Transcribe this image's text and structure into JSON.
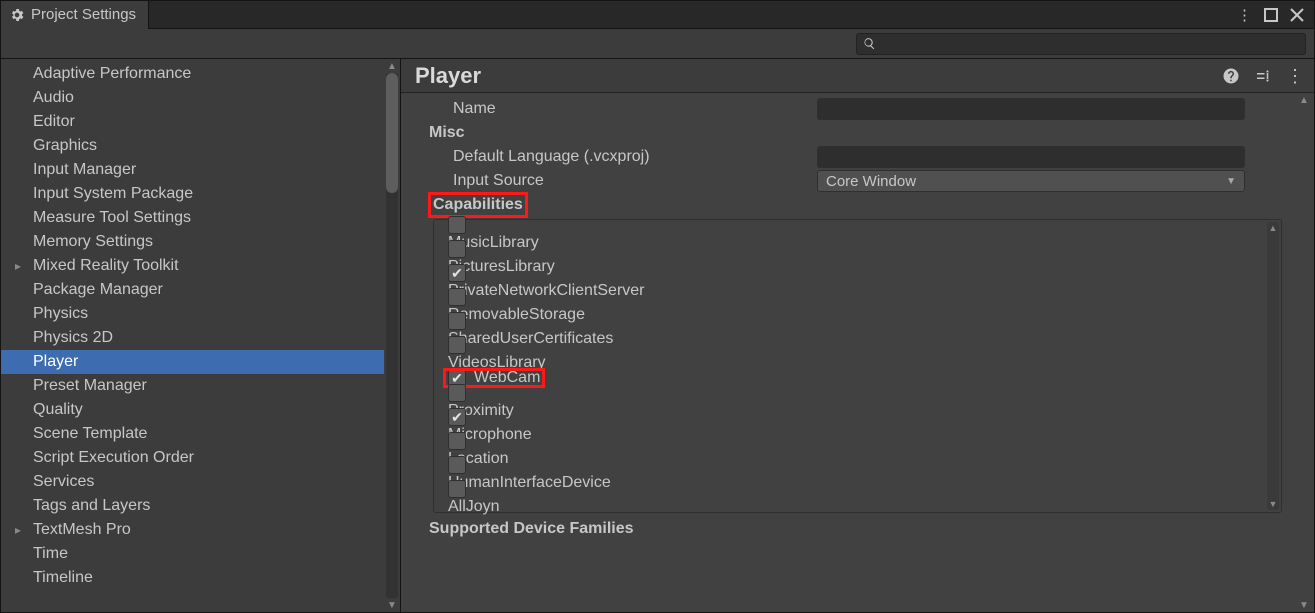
{
  "window": {
    "tab_title": "Project Settings"
  },
  "search": {
    "placeholder": ""
  },
  "sidebar": {
    "items": [
      {
        "label": "Adaptive Performance",
        "expandable": false
      },
      {
        "label": "Audio",
        "expandable": false
      },
      {
        "label": "Editor",
        "expandable": false
      },
      {
        "label": "Graphics",
        "expandable": false
      },
      {
        "label": "Input Manager",
        "expandable": false
      },
      {
        "label": "Input System Package",
        "expandable": false
      },
      {
        "label": "Measure Tool Settings",
        "expandable": false
      },
      {
        "label": "Memory Settings",
        "expandable": false
      },
      {
        "label": "Mixed Reality Toolkit",
        "expandable": true
      },
      {
        "label": "Package Manager",
        "expandable": false
      },
      {
        "label": "Physics",
        "expandable": false
      },
      {
        "label": "Physics 2D",
        "expandable": false
      },
      {
        "label": "Player",
        "expandable": false,
        "selected": true
      },
      {
        "label": "Preset Manager",
        "expandable": false
      },
      {
        "label": "Quality",
        "expandable": false
      },
      {
        "label": "Scene Template",
        "expandable": false
      },
      {
        "label": "Script Execution Order",
        "expandable": false
      },
      {
        "label": "Services",
        "expandable": false
      },
      {
        "label": "Tags and Layers",
        "expandable": false
      },
      {
        "label": "TextMesh Pro",
        "expandable": true
      },
      {
        "label": "Time",
        "expandable": false
      },
      {
        "label": "Timeline",
        "expandable": false
      }
    ]
  },
  "main": {
    "title": "Player",
    "name_label": "Name",
    "name_value": "",
    "misc_label": "Misc",
    "default_language_label": "Default Language (.vcxproj)",
    "default_language_value": "",
    "input_source_label": "Input Source",
    "input_source_value": "Core Window",
    "capabilities_label": "Capabilities",
    "capabilities": [
      {
        "label": "MusicLibrary",
        "checked": false
      },
      {
        "label": "PicturesLibrary",
        "checked": false
      },
      {
        "label": "PrivateNetworkClientServer",
        "checked": true
      },
      {
        "label": "RemovableStorage",
        "checked": false
      },
      {
        "label": "SharedUserCertificates",
        "checked": false
      },
      {
        "label": "VideosLibrary",
        "checked": false
      },
      {
        "label": "WebCam",
        "checked": true,
        "highlighted": true
      },
      {
        "label": "Proximity",
        "checked": false
      },
      {
        "label": "Microphone",
        "checked": true
      },
      {
        "label": "Location",
        "checked": false
      },
      {
        "label": "HumanInterfaceDevice",
        "checked": false
      },
      {
        "label": "AllJoyn",
        "checked": false
      }
    ],
    "supported_families_label": "Supported Device Families",
    "capabilities_highlighted": true
  }
}
